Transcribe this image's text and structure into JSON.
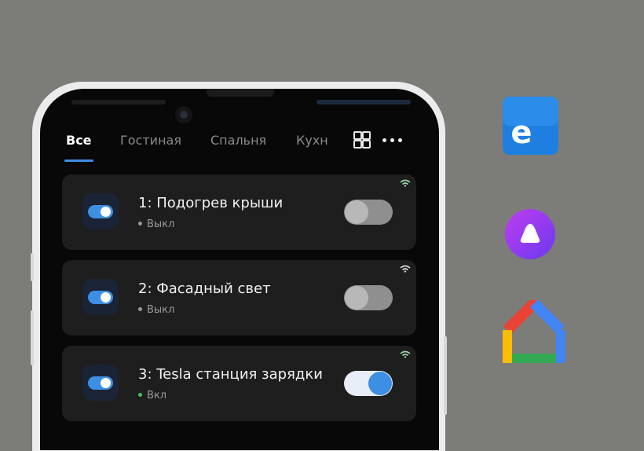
{
  "tabs": {
    "items": [
      {
        "label": "Все",
        "active": true
      },
      {
        "label": "Гостиная",
        "active": false
      },
      {
        "label": "Спальня",
        "active": false
      },
      {
        "label": "Кухн",
        "active": false
      }
    ]
  },
  "toolbar": {
    "grid_icon": "grid-icon",
    "more_icon": "more-dots-icon"
  },
  "devices": [
    {
      "title": "1: Подогрев крыши",
      "status": "Выкл",
      "on": false
    },
    {
      "title": "2: Фасадный свет",
      "status": "Выкл",
      "on": false
    },
    {
      "title": "3: Tesla станция зарядки",
      "status": "Вкл",
      "on": true
    }
  ],
  "integrations": [
    {
      "icon": "ewelink-icon"
    },
    {
      "icon": "alice-icon"
    },
    {
      "icon": "google-home-icon"
    }
  ],
  "colors": {
    "accent": "#3d8fe3",
    "background": "#7c7c78",
    "screen": "#080808",
    "card": "#1e1e1e",
    "status_off": "#9a9a9a",
    "status_on": "#4cbe5e"
  }
}
